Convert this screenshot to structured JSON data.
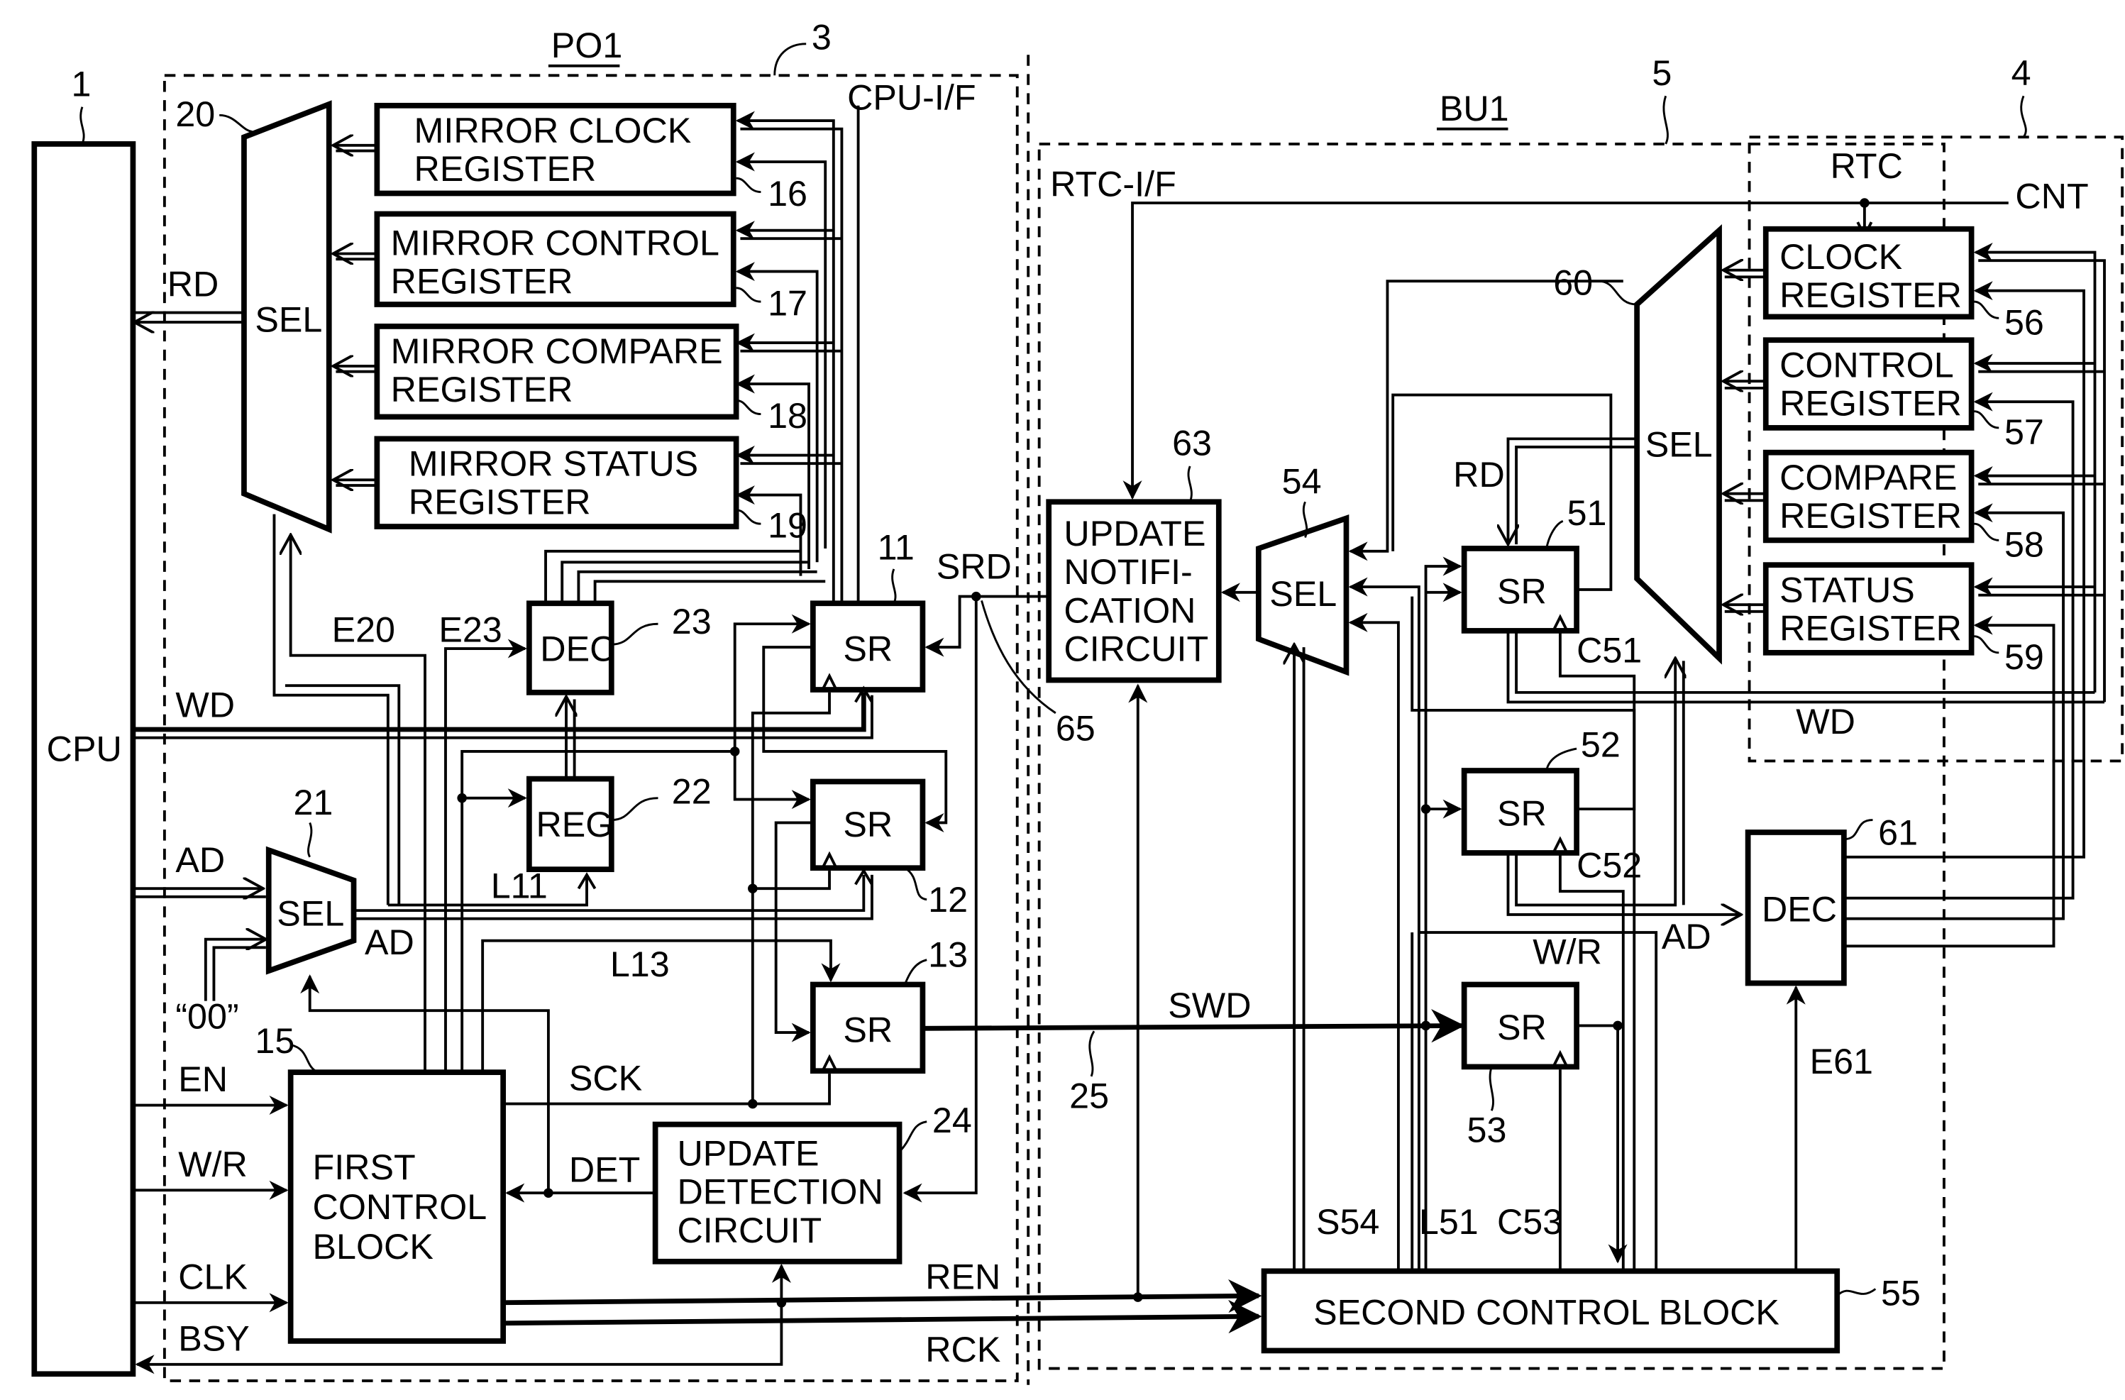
{
  "title_left": "PO1",
  "title_right": "BU1",
  "refs": {
    "cpu_ref": "1",
    "cpu_if_ref": "3",
    "rtc_ref": "4",
    "rtc_if_ref": "5",
    "sel20": "20",
    "sel21": "21",
    "reg22": "22",
    "dec23": "23",
    "udc24": "24",
    "line25": "25",
    "sr11": "11",
    "sr12": "12",
    "sr13": "13",
    "fcb15": "15",
    "mreg16": "16",
    "mreg17": "17",
    "mreg18": "18",
    "mreg19": "19",
    "sr51": "51",
    "sr52": "52",
    "sr53": "53",
    "sel54": "54",
    "scb55": "55",
    "reg56": "56",
    "reg57": "57",
    "reg58": "58",
    "reg59": "59",
    "sel60": "60",
    "dec61": "61",
    "unc63": "63",
    "node65": "65"
  },
  "blocks": {
    "cpu": "CPU",
    "cpu_if": "CPU-I/F",
    "rtc_if": "RTC-I/F",
    "rtc": "RTC",
    "sel": "SEL",
    "dec": "DEC",
    "reg": "REG",
    "sr": "SR",
    "mirror_clock": [
      "MIRROR CLOCK",
      "REGISTER"
    ],
    "mirror_control": [
      "MIRROR CONTROL",
      "REGISTER"
    ],
    "mirror_compare": [
      "MIRROR COMPARE",
      "REGISTER"
    ],
    "mirror_status": [
      "MIRROR STATUS",
      "REGISTER"
    ],
    "first_control": [
      "FIRST",
      "CONTROL",
      "BLOCK"
    ],
    "update_detection": [
      "UPDATE",
      "DETECTION",
      "CIRCUIT"
    ],
    "update_notification": [
      "UPDATE",
      "NOTIFI-",
      "CATION",
      "CIRCUIT"
    ],
    "second_control": "SECOND CONTROL BLOCK",
    "clock_register": [
      "CLOCK",
      "REGISTER"
    ],
    "control_register": [
      "CONTROL",
      "REGISTER"
    ],
    "compare_register": [
      "COMPARE",
      "REGISTER"
    ],
    "status_register": [
      "STATUS",
      "REGISTER"
    ]
  },
  "signals": {
    "rd": "RD",
    "wd": "WD",
    "ad": "AD",
    "zero": "“00”",
    "en": "EN",
    "wr": "W/R",
    "clk": "CLK",
    "bsy": "BSY",
    "e20": "E20",
    "e23": "E23",
    "l11": "L11",
    "l13": "L13",
    "sck": "SCK",
    "det": "DET",
    "srd": "SRD",
    "swd": "SWD",
    "ren": "REN",
    "rck": "RCK",
    "cnt": "CNT",
    "c51": "C51",
    "c52": "C52",
    "c53": "C53",
    "l51": "L51",
    "s54": "S54",
    "e61": "E61"
  }
}
